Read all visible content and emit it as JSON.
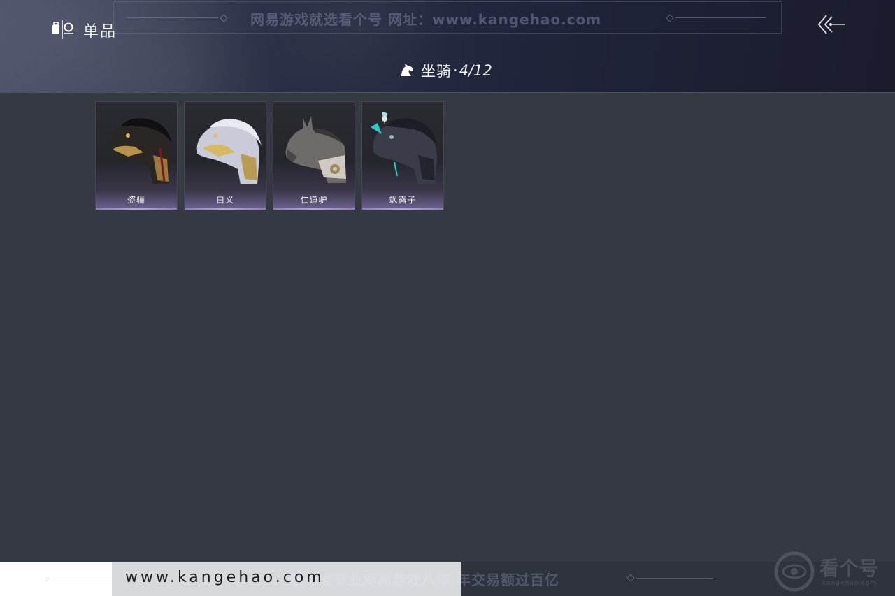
{
  "header": {
    "section_label": "单品",
    "category_title": "坐骑",
    "category_separator": "·",
    "category_count": "4/12",
    "watermark_top": "网易游戏就选看个号   网址：www.kangehao.com"
  },
  "items": [
    {
      "name": "盗骊",
      "icon": "dark-horse-icon"
    },
    {
      "name": "白义",
      "icon": "white-horse-icon"
    },
    {
      "name": "仁道驴",
      "icon": "donkey-icon"
    },
    {
      "name": "飒露子",
      "icon": "armored-horse-icon"
    }
  ],
  "footer": {
    "site_url": "www.kangehao.com",
    "watermark_bottom": "看个号专业网易游戏八年   年交易额过百亿",
    "logo_text": "看个号",
    "logo_sub": "kangehao.com"
  },
  "colors": {
    "background": "#353942",
    "card_accent": "#b5a8dc",
    "header_dark": "#20243a"
  }
}
